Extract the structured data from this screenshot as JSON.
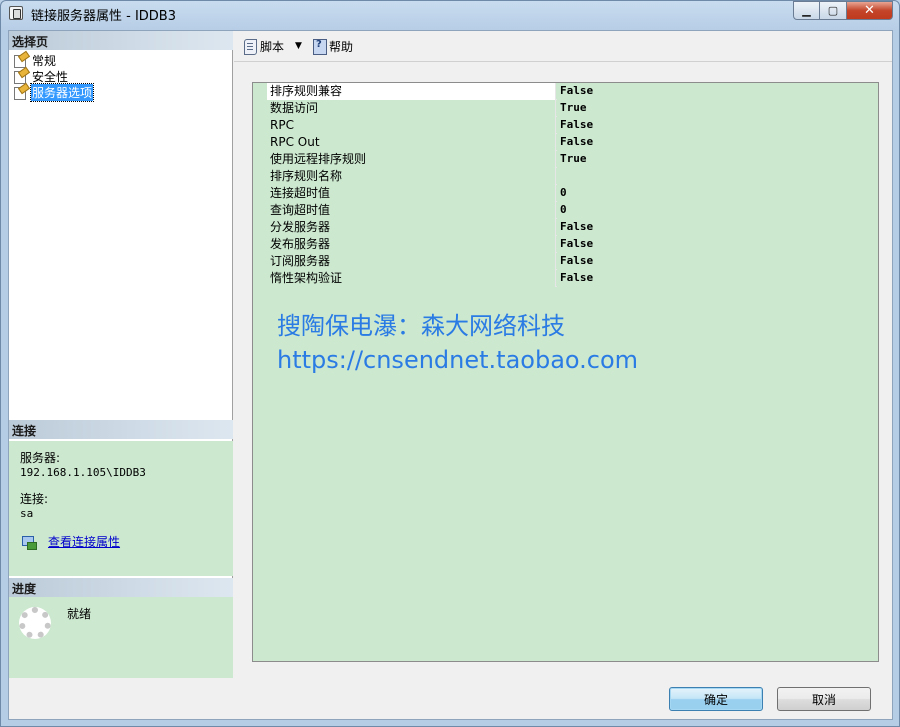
{
  "window": {
    "title": "链接服务器属性 - IDDB3",
    "min_icon": "minimize-icon",
    "max_icon": "maximize-icon",
    "close_icon": "close-icon"
  },
  "sidebar": {
    "header": "选择页",
    "pages": [
      {
        "label": "常规",
        "selected": false
      },
      {
        "label": "安全性",
        "selected": false
      },
      {
        "label": "服务器选项",
        "selected": true
      }
    ]
  },
  "connection": {
    "header": "连接",
    "server_label": "服务器:",
    "server_value": "192.168.1.105\\IDDB3",
    "login_label": "连接:",
    "login_value": "sa",
    "link_label": "查看连接属性"
  },
  "progress": {
    "header": "进度",
    "status": "就绪"
  },
  "toolbar": {
    "script_label": "脚本",
    "dropdown_glyph": "▼",
    "help_label": "帮助"
  },
  "properties": [
    {
      "name": "排序规则兼容",
      "value": "False"
    },
    {
      "name": "数据访问",
      "value": "True"
    },
    {
      "name": "RPC",
      "value": "False"
    },
    {
      "name": "RPC Out",
      "value": "False"
    },
    {
      "name": "使用远程排序规则",
      "value": "True"
    },
    {
      "name": "排序规则名称",
      "value": ""
    },
    {
      "name": "连接超时值",
      "value": "0"
    },
    {
      "name": "查询超时值",
      "value": "0"
    },
    {
      "name": "分发服务器",
      "value": "False"
    },
    {
      "name": "发布服务器",
      "value": "False"
    },
    {
      "name": "订阅服务器",
      "value": "False"
    },
    {
      "name": "惰性架构验证",
      "value": "False"
    }
  ],
  "watermark": {
    "line1": "搜陶保电瀑：森大网络科技",
    "line2": "https://cnsendnet.taobao.com"
  },
  "buttons": {
    "ok": "确定",
    "cancel": "取消"
  },
  "colors": {
    "panel_green": "#cce8cf",
    "selection_blue": "#3399ff",
    "watermark_blue": "#2a7be4",
    "link_blue": "#0000cc"
  }
}
